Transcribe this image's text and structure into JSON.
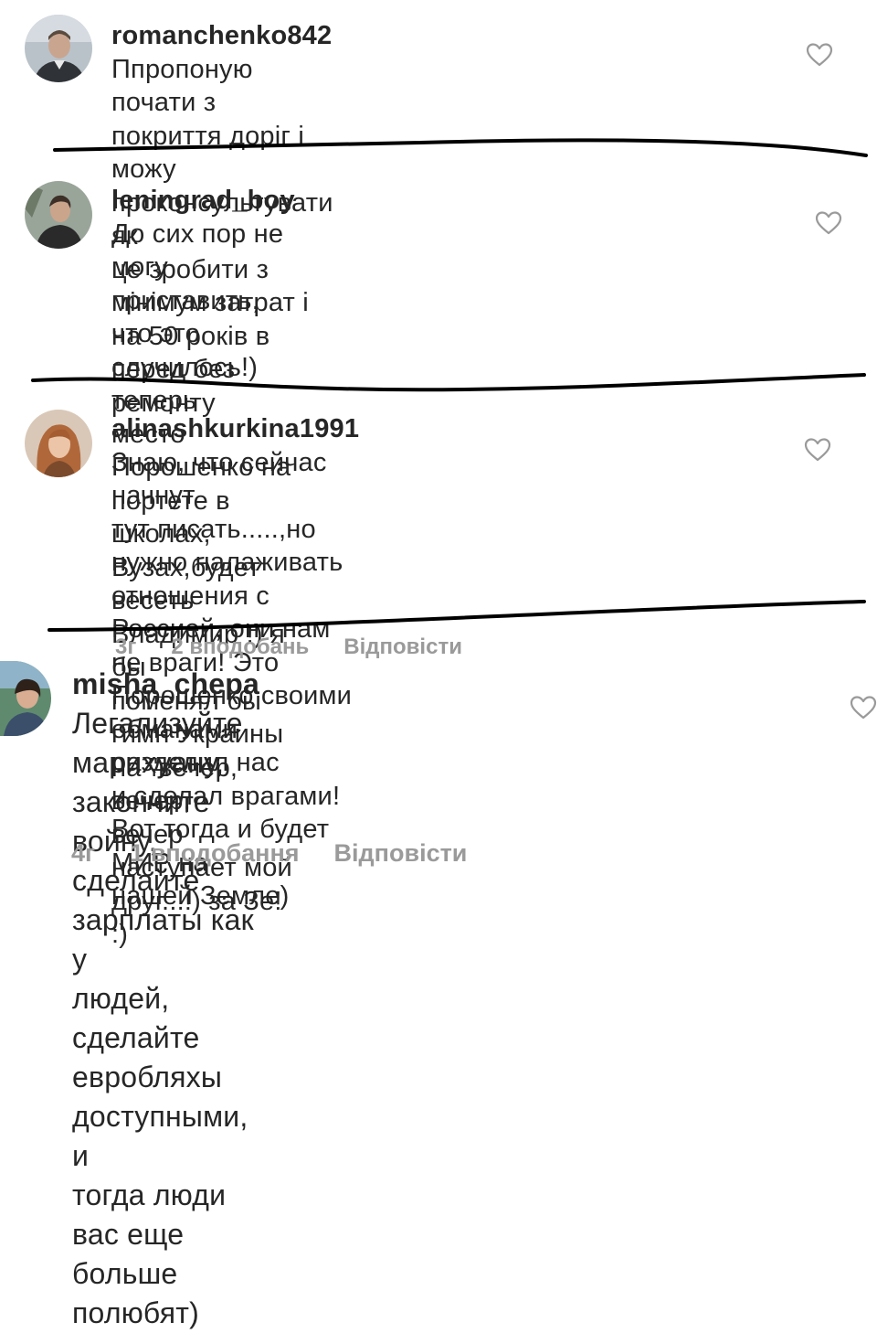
{
  "comments": [
    {
      "username": "romanchenko842",
      "lines": [
        "Ппропоную почати з",
        "покриття доріг і можу проконсультувати як",
        "це зробити з мінімум затрат і на 50 років в",
        "перед без ремонту"
      ]
    },
    {
      "username": "leningrad_boy",
      "lines": [
        "До сих пор не могу",
        "приставить, что это случилось!) теперь",
        "место Порошенко на портете в школах,",
        "Вузах,будет весеть Владимир !) я бы",
        "поменял бы гимн Украины на \"вечер, вечер,",
        "вечер наступает мой друг...!) за Зе! :)"
      ]
    },
    {
      "username": "alinashkurkina1991",
      "lines": [
        "Знаю, что сейчас начнут",
        "тут писать.....,но нужно налаживать",
        "отношения с Россией, они нам не враги! Это",
        "Порошенко своими обманами разделил нас",
        "и сделал врагами! Вот тогда и будет МИР на",
        "нашей Земле)"
      ],
      "meta": {
        "time": "3г",
        "likes": "2 вподобань",
        "reply": "Відповісти"
      }
    },
    {
      "username": "misha_chepa",
      "lines": [
        "Легализуйте марихуану,",
        "закончите войну, сделайте зарплаты как у",
        "людей, сделайте евробляхы доступными, и",
        "тогда люди вас еще больше полюбят)"
      ],
      "meta": {
        "time": "4г",
        "likes": "1 вподобання",
        "reply": "Відповісти"
      }
    }
  ],
  "icons": {
    "like": "heart-outline-icon",
    "avatar": "user-avatar"
  },
  "colors": {
    "text": "#262626",
    "meta": "#9a9a9a",
    "heart": "#9a9a9a",
    "strike": "#000000"
  }
}
